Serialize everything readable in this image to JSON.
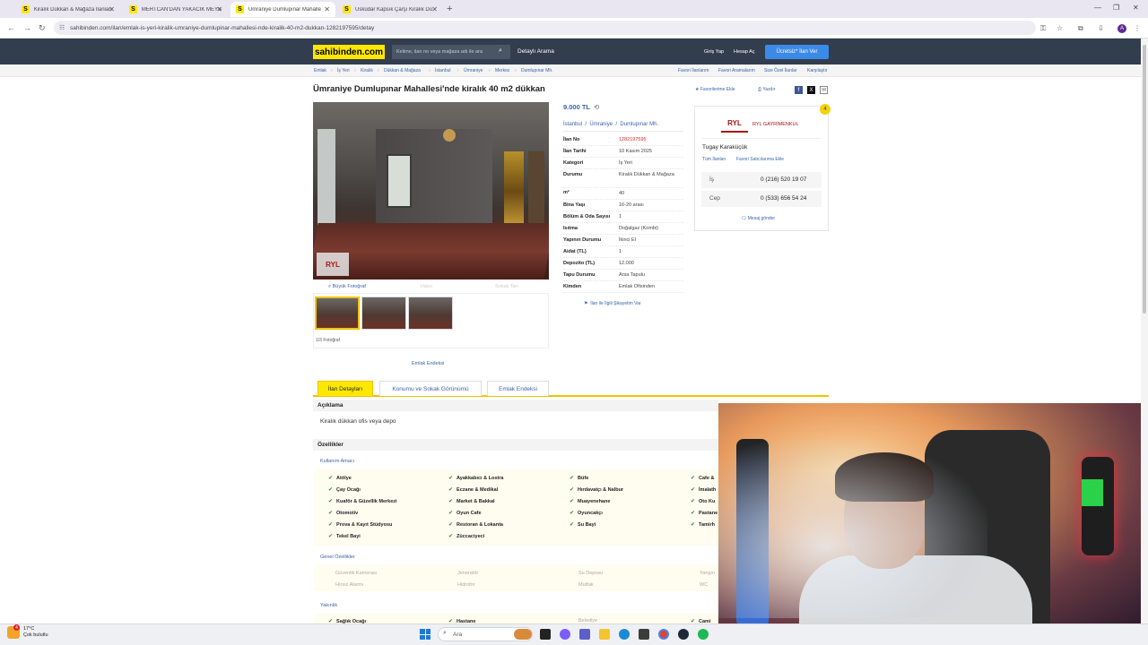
{
  "browser": {
    "tabs": [
      {
        "title": "Kiralık Dükkan & Mağaza İlanları",
        "icon": "S"
      },
      {
        "title": "MERTCAN'DAN YAKACIK MEYS",
        "icon": "S"
      },
      {
        "title": "Ümraniye Dumlupınar Mahalle",
        "icon": "S"
      },
      {
        "title": "Üsküdar Kapsık Çarşı Kiralık Dü",
        "icon": "S"
      }
    ],
    "url": "sahibinden.com/ilan/emlak-is-yeri-kiralik-umraniye-dumlupinar-mahallesi-nde-kiralik-40-m2-dukkan-1282197595/detay",
    "profile_initial": "A"
  },
  "header": {
    "logo": "sahibinden.com",
    "search_placeholder": "Kelime, ilan no veya mağaza adı ile ara",
    "detailed_search": "Detaylı Arama",
    "login": "Giriş Yap",
    "register": "Hesap Aç",
    "post_ad": "Ücretsiz* İlan Ver"
  },
  "breadcrumb": [
    "Emlak",
    "İş Yeri",
    "Kiralık",
    "Dükkan & Mağaza",
    "İstanbul",
    "Ümraniye",
    "Merkez",
    "Dumlupınar Mh."
  ],
  "top_links": [
    "Favori İlanlarım",
    "Favori Aramalarım",
    "Size Özel İlanlar",
    "Karşılaştır"
  ],
  "listing": {
    "title": "Ümraniye Dumlupınar Mahallesi'nde kiralık 40 m2 dükkan",
    "add_favorite": "Favorilerime Ekle",
    "print": "Yazdır",
    "price": "9.000 TL",
    "location": [
      "İstanbul",
      "Ümraniye",
      "Dumlupınar Mh."
    ],
    "details": [
      {
        "key": "İlan No",
        "value": "1282197595"
      },
      {
        "key": "İlan Tarihi",
        "value": "10 Kasım 2025"
      },
      {
        "key": "Kategori",
        "value": "İş Yeri"
      },
      {
        "key": "Durumu",
        "value": "Kiralık Dükkan & Mağaza"
      },
      {
        "key": "m²",
        "value": "40"
      },
      {
        "key": "Bina Yaşı",
        "value": "16-20 arası"
      },
      {
        "key": "Bölüm & Oda Sayısı",
        "value": "1"
      },
      {
        "key": "Isıtma",
        "value": "Doğalgaz (Kombi)"
      },
      {
        "key": "Yapının Durumu",
        "value": "İkinci El"
      },
      {
        "key": "Aidat (TL)",
        "value": "1"
      },
      {
        "key": "Depozito (TL)",
        "value": "12.000"
      },
      {
        "key": "Tapu Durumu",
        "value": "Arsa Tapulu"
      },
      {
        "key": "Kimden",
        "value": "Emlak Ofisinden"
      }
    ],
    "complain": "İlan ile İlgili Şikayetim Var",
    "photo_big": "Büyük Fotoğraf",
    "photo_video": "Video",
    "photo_map": "Sokak Tarı",
    "photo_count": "1/3 Fotoğraf",
    "emlak_endeksi": "Emlak Endeksi",
    "photo_watermark": "RYL"
  },
  "seller": {
    "logo": "RYL",
    "company": "RYL GAYRİMENKUL",
    "badge": "4",
    "person": "Tugay Karaküçük",
    "all_ads": "Tüm İlanları",
    "fav_seller": "Favori Satıcılarıma Ekle",
    "phones": [
      {
        "label": "İş",
        "number": "0 (216) 520 19 07"
      },
      {
        "label": "Cep",
        "number": "0 (533) 656 54 24"
      }
    ],
    "message": "Mesaj gönder"
  },
  "detail_tabs": [
    "İlan Detayları",
    "Konumu ve Sokak Görünümü",
    "Emlak Endeksi"
  ],
  "description": {
    "heading": "Açıklama",
    "text": "Kiralık dükkan ofis veya depo"
  },
  "features": {
    "heading": "Özellikler",
    "usage_label": "Kullanım Amacı",
    "usage": [
      [
        "Atölye",
        "Çay Ocağı",
        "Kuaför & Güzellik Merkezi",
        "Otomotiv",
        "Prova & Kayıt Stüdyosu",
        "Tekel Bayi"
      ],
      [
        "Ayakkabıcı & Lostra",
        "Eczane & Medikal",
        "Market & Bakkal",
        "Oyun Cafe",
        "Restoran & Lokanta",
        "Züccaciyeci"
      ],
      [
        "Büfe",
        "Hırdavatçı & Nalbur",
        "Muayenehane",
        "Oyuncakçı",
        "Su Bayi"
      ],
      [
        "Cafe &",
        "İmalath",
        "Oto Ku",
        "Pastane",
        "Tamirh"
      ]
    ],
    "general_label": "Genel Özellikler",
    "general": [
      "Güvenlik Kamerası",
      "Jeneratör",
      "Su Deposu",
      "Yangın",
      "Hırsız Alarmı",
      "Hidrofor",
      "Mutfak",
      "WC"
    ],
    "nearby_label": "Yakınlık",
    "nearby": [
      "Sağlık Ocağı",
      "Hastane",
      "Belediye",
      "Cami"
    ]
  },
  "taskbar": {
    "temp": "17°C",
    "weather": "Çok bulutlu",
    "notif": "4",
    "search": "Ara"
  }
}
